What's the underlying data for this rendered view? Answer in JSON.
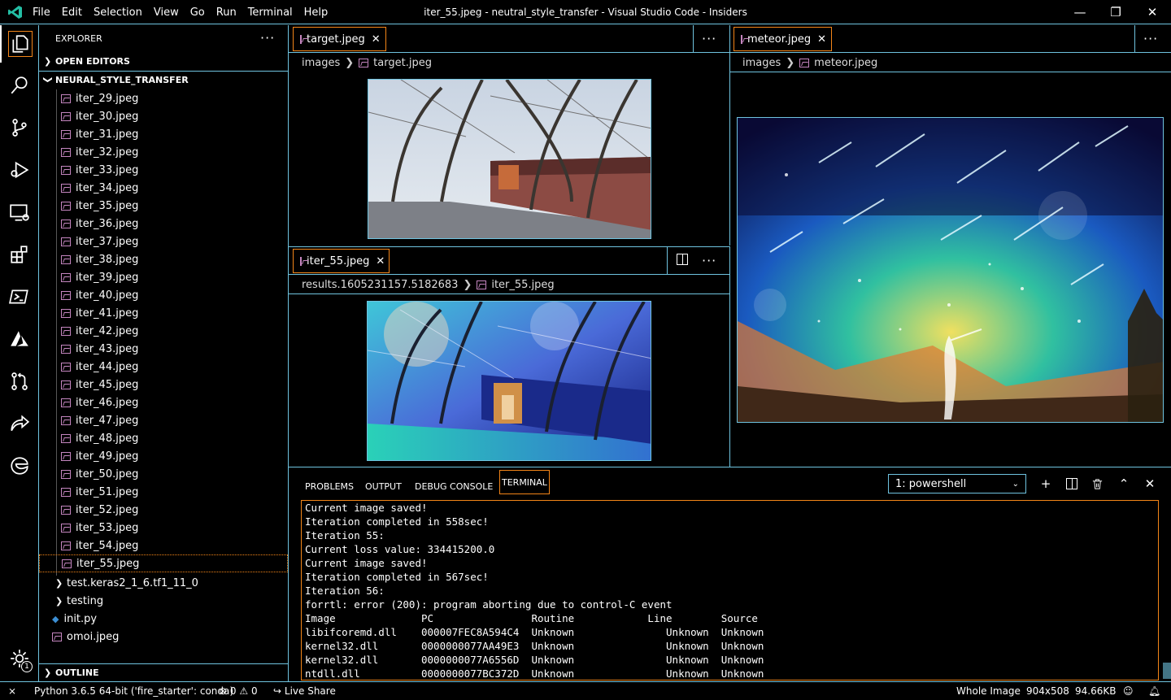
{
  "window": {
    "title": "iter_55.jpeg - neutral_style_transfer - Visual Studio Code - Insiders",
    "menu": [
      "File",
      "Edit",
      "Selection",
      "View",
      "Go",
      "Run",
      "Terminal",
      "Help"
    ],
    "controls": {
      "minimize": "—",
      "maximize": "❐",
      "close": "✕"
    }
  },
  "activity_bar": [
    "files-icon",
    "search-icon",
    "source-control-icon",
    "run-debug-icon",
    "remote-explorer-icon",
    "extensions-icon",
    "powershell-icon",
    "azure-icon",
    "pull-request-icon",
    "live-share-icon",
    "edge-icon"
  ],
  "sidebar": {
    "title": "EXPLORER",
    "more": "···",
    "open_editors": "OPEN EDITORS",
    "folder": "NEURAL_STYLE_TRANSFER",
    "files": [
      "iter_29.jpeg",
      "iter_30.jpeg",
      "iter_31.jpeg",
      "iter_32.jpeg",
      "iter_33.jpeg",
      "iter_34.jpeg",
      "iter_35.jpeg",
      "iter_36.jpeg",
      "iter_37.jpeg",
      "iter_38.jpeg",
      "iter_39.jpeg",
      "iter_40.jpeg",
      "iter_41.jpeg",
      "iter_42.jpeg",
      "iter_43.jpeg",
      "iter_44.jpeg",
      "iter_45.jpeg",
      "iter_46.jpeg",
      "iter_47.jpeg",
      "iter_48.jpeg",
      "iter_49.jpeg",
      "iter_50.jpeg",
      "iter_51.jpeg",
      "iter_52.jpeg",
      "iter_53.jpeg",
      "iter_54.jpeg",
      "iter_55.jpeg"
    ],
    "folders": [
      "test.keras2_1_6.tf1_11_0",
      "testing"
    ],
    "root_files": [
      "init.py",
      "omoi.jpeg"
    ],
    "outline": "OUTLINE",
    "settings_badge": "1"
  },
  "editors": {
    "group1": {
      "tab": "target.jpeg",
      "crumb_folder": "images",
      "crumb_file": "target.jpeg",
      "more": "···"
    },
    "group2": {
      "tab": "iter_55.jpeg",
      "crumb_folder": "results.1605231157.5182683",
      "crumb_file": "iter_55.jpeg",
      "more": "···"
    },
    "group3": {
      "tab": "meteor.jpeg",
      "crumb_folder": "images",
      "crumb_file": "meteor.jpeg",
      "more": "···"
    }
  },
  "panel": {
    "tabs": [
      "PROBLEMS",
      "OUTPUT",
      "DEBUG CONSOLE",
      "TERMINAL"
    ],
    "active_tab": "TERMINAL",
    "terminal_select": "1: powershell",
    "terminal_lines": [
      "Current image saved!",
      "Iteration completed in 558sec!",
      "Iteration 55:",
      "Current loss value: 334415200.0",
      "Current image saved!",
      "Iteration completed in 567sec!",
      "Iteration 56:",
      "forrtl: error (200): program aborting due to control-C event",
      "Image              PC                Routine            Line        Source",
      "libifcoremd.dll    000007FEC8A594C4  Unknown               Unknown  Unknown",
      "kernel32.dll       0000000077AA49E3  Unknown               Unknown  Unknown",
      "kernel32.dll       0000000077A6556D  Unknown               Unknown  Unknown",
      "ntdll.dll          0000000077BC372D  Unknown               Unknown  Unknown"
    ]
  },
  "status_bar": {
    "remote": "⨯",
    "python": "Python 3.6.5 64-bit ('fire_starter': conda)",
    "errors": "0",
    "warnings": "0",
    "live_share": "Live Share",
    "image_scale": "Whole Image",
    "image_dims": "904x508",
    "image_size": "94.66KB"
  },
  "colors": {
    "border": "#6fc3df",
    "active_border": "#f38518",
    "icon_purple": "#c586c0",
    "accent": "#23aaf2"
  }
}
